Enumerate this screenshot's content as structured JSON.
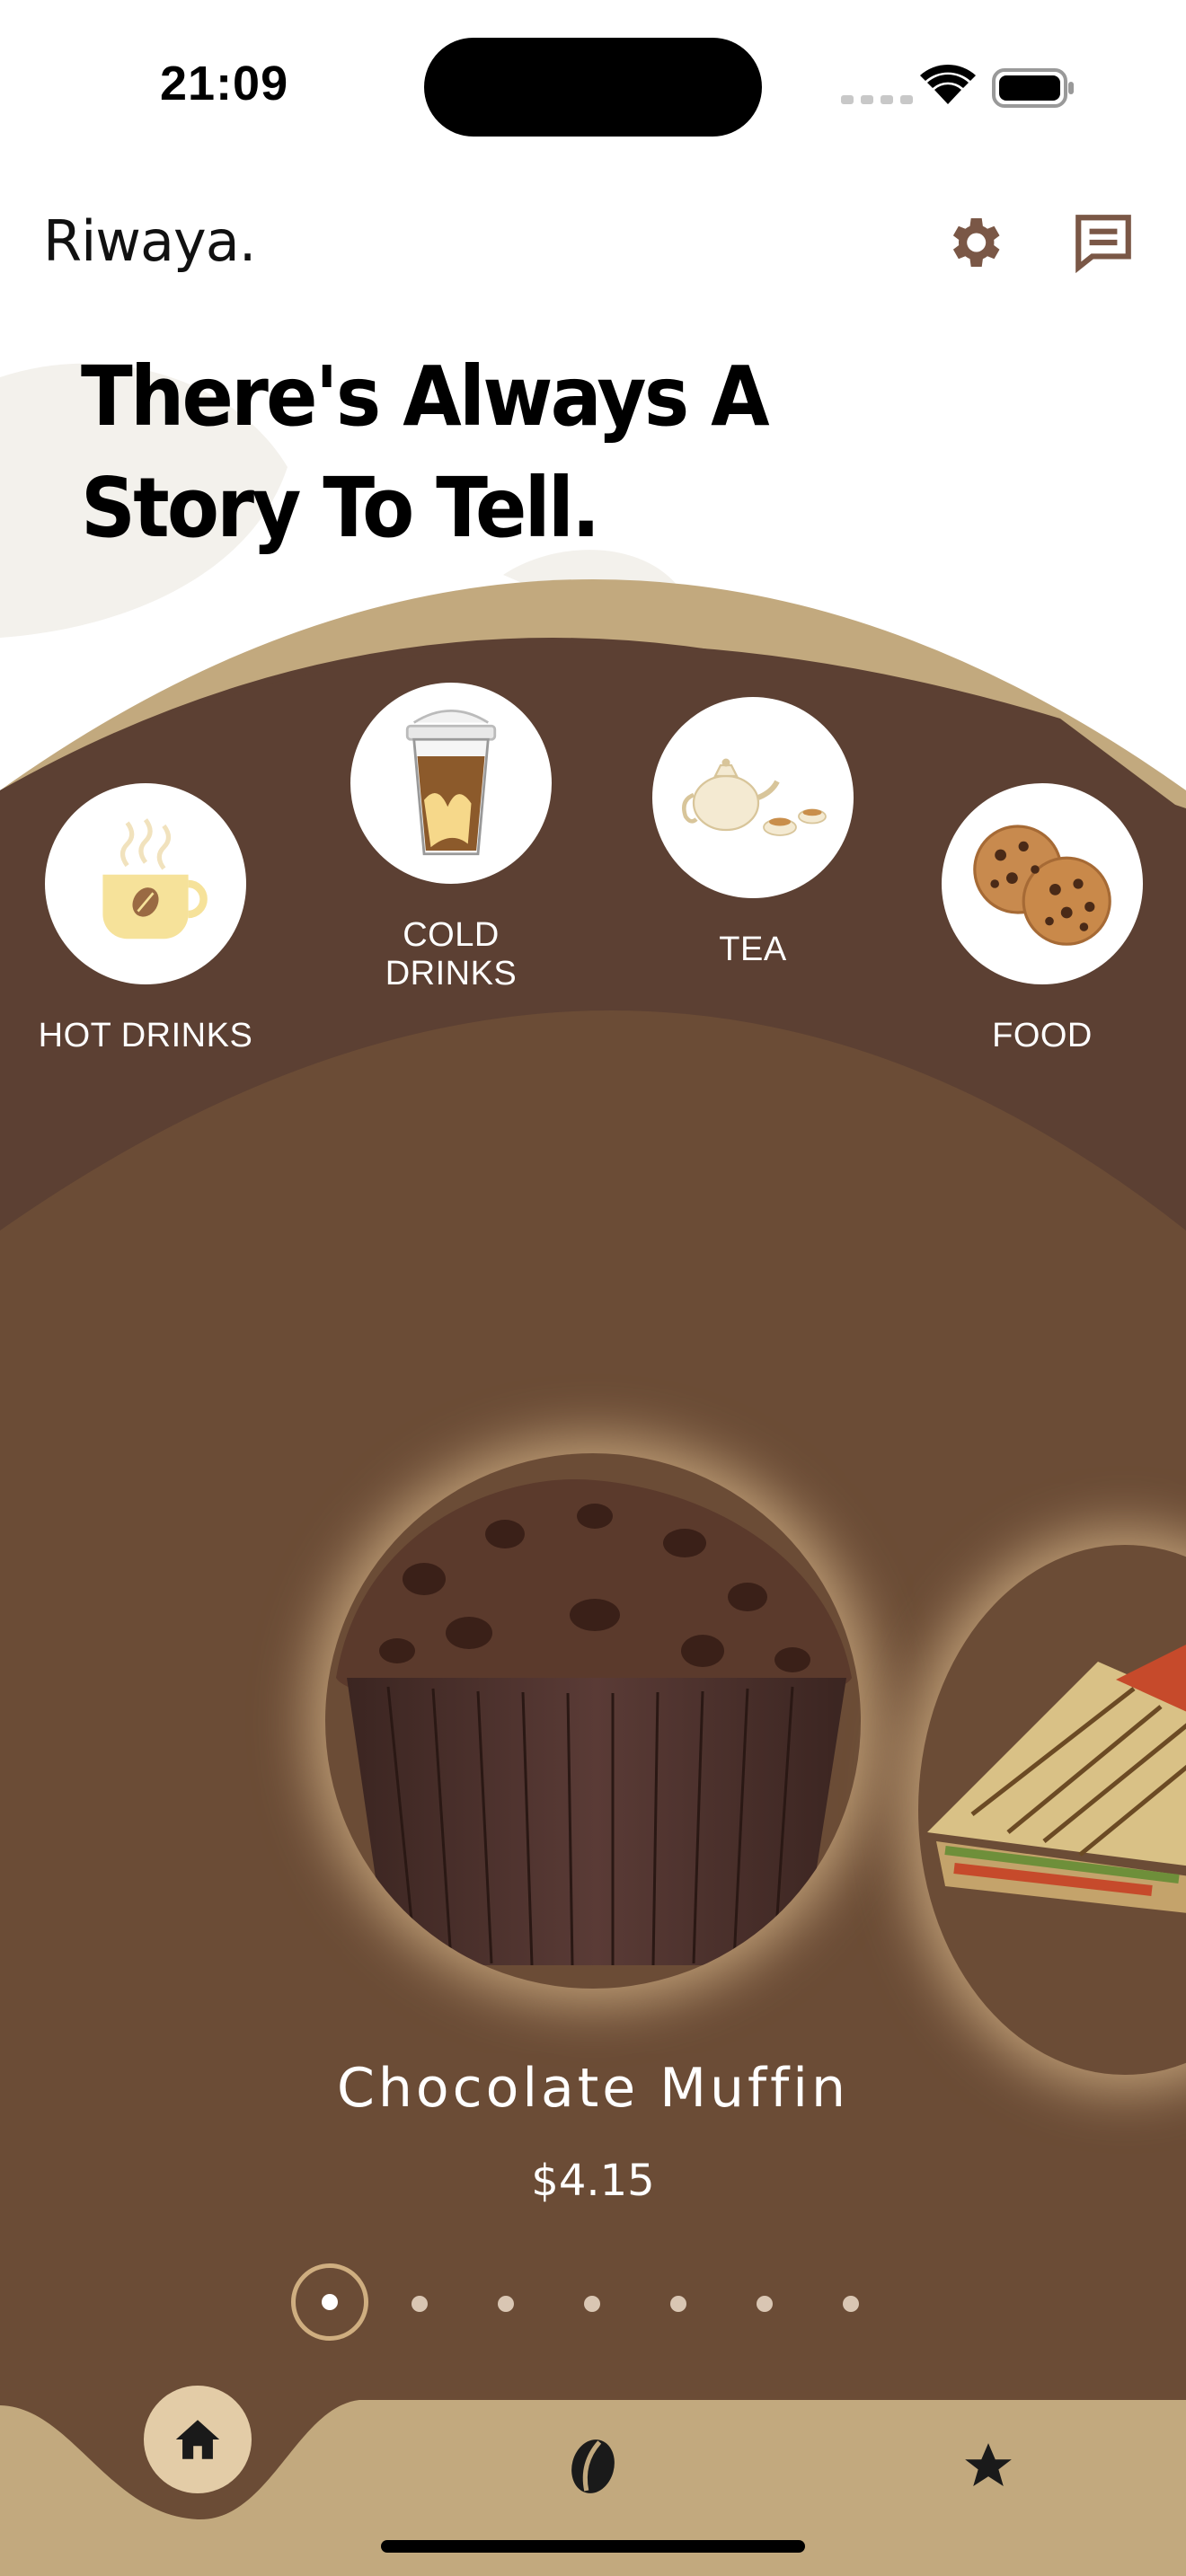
{
  "status_bar": {
    "time": "21:09"
  },
  "header": {
    "brand": "Riwaya.",
    "settings_icon": "gear-icon",
    "messages_icon": "message-icon",
    "tagline": "There's Always A\nStory To Tell."
  },
  "categories": [
    {
      "label": "HOT DRINKS",
      "icon": "hot-coffee-cup"
    },
    {
      "label": "COLD DRINKS",
      "icon": "iced-coffee-cup"
    },
    {
      "label": "TEA",
      "icon": "teapot-set"
    },
    {
      "label": "FOOD",
      "icon": "cookies"
    }
  ],
  "product": {
    "name": "Chocolate Muffin",
    "price": "$4.15",
    "image": "chocolate-muffin",
    "next_image": "grilled-sandwich"
  },
  "carousel": {
    "count": 7,
    "active": 1
  },
  "bottom_nav": [
    {
      "icon": "home-icon",
      "active": true
    },
    {
      "icon": "coffee-bean-icon",
      "active": false
    },
    {
      "icon": "star-icon",
      "active": false
    }
  ],
  "colors": {
    "dark_brown": "#5c4033",
    "mid_brown": "#6b4c36",
    "tan": "#c2a97e",
    "cream": "#f3d98e"
  }
}
